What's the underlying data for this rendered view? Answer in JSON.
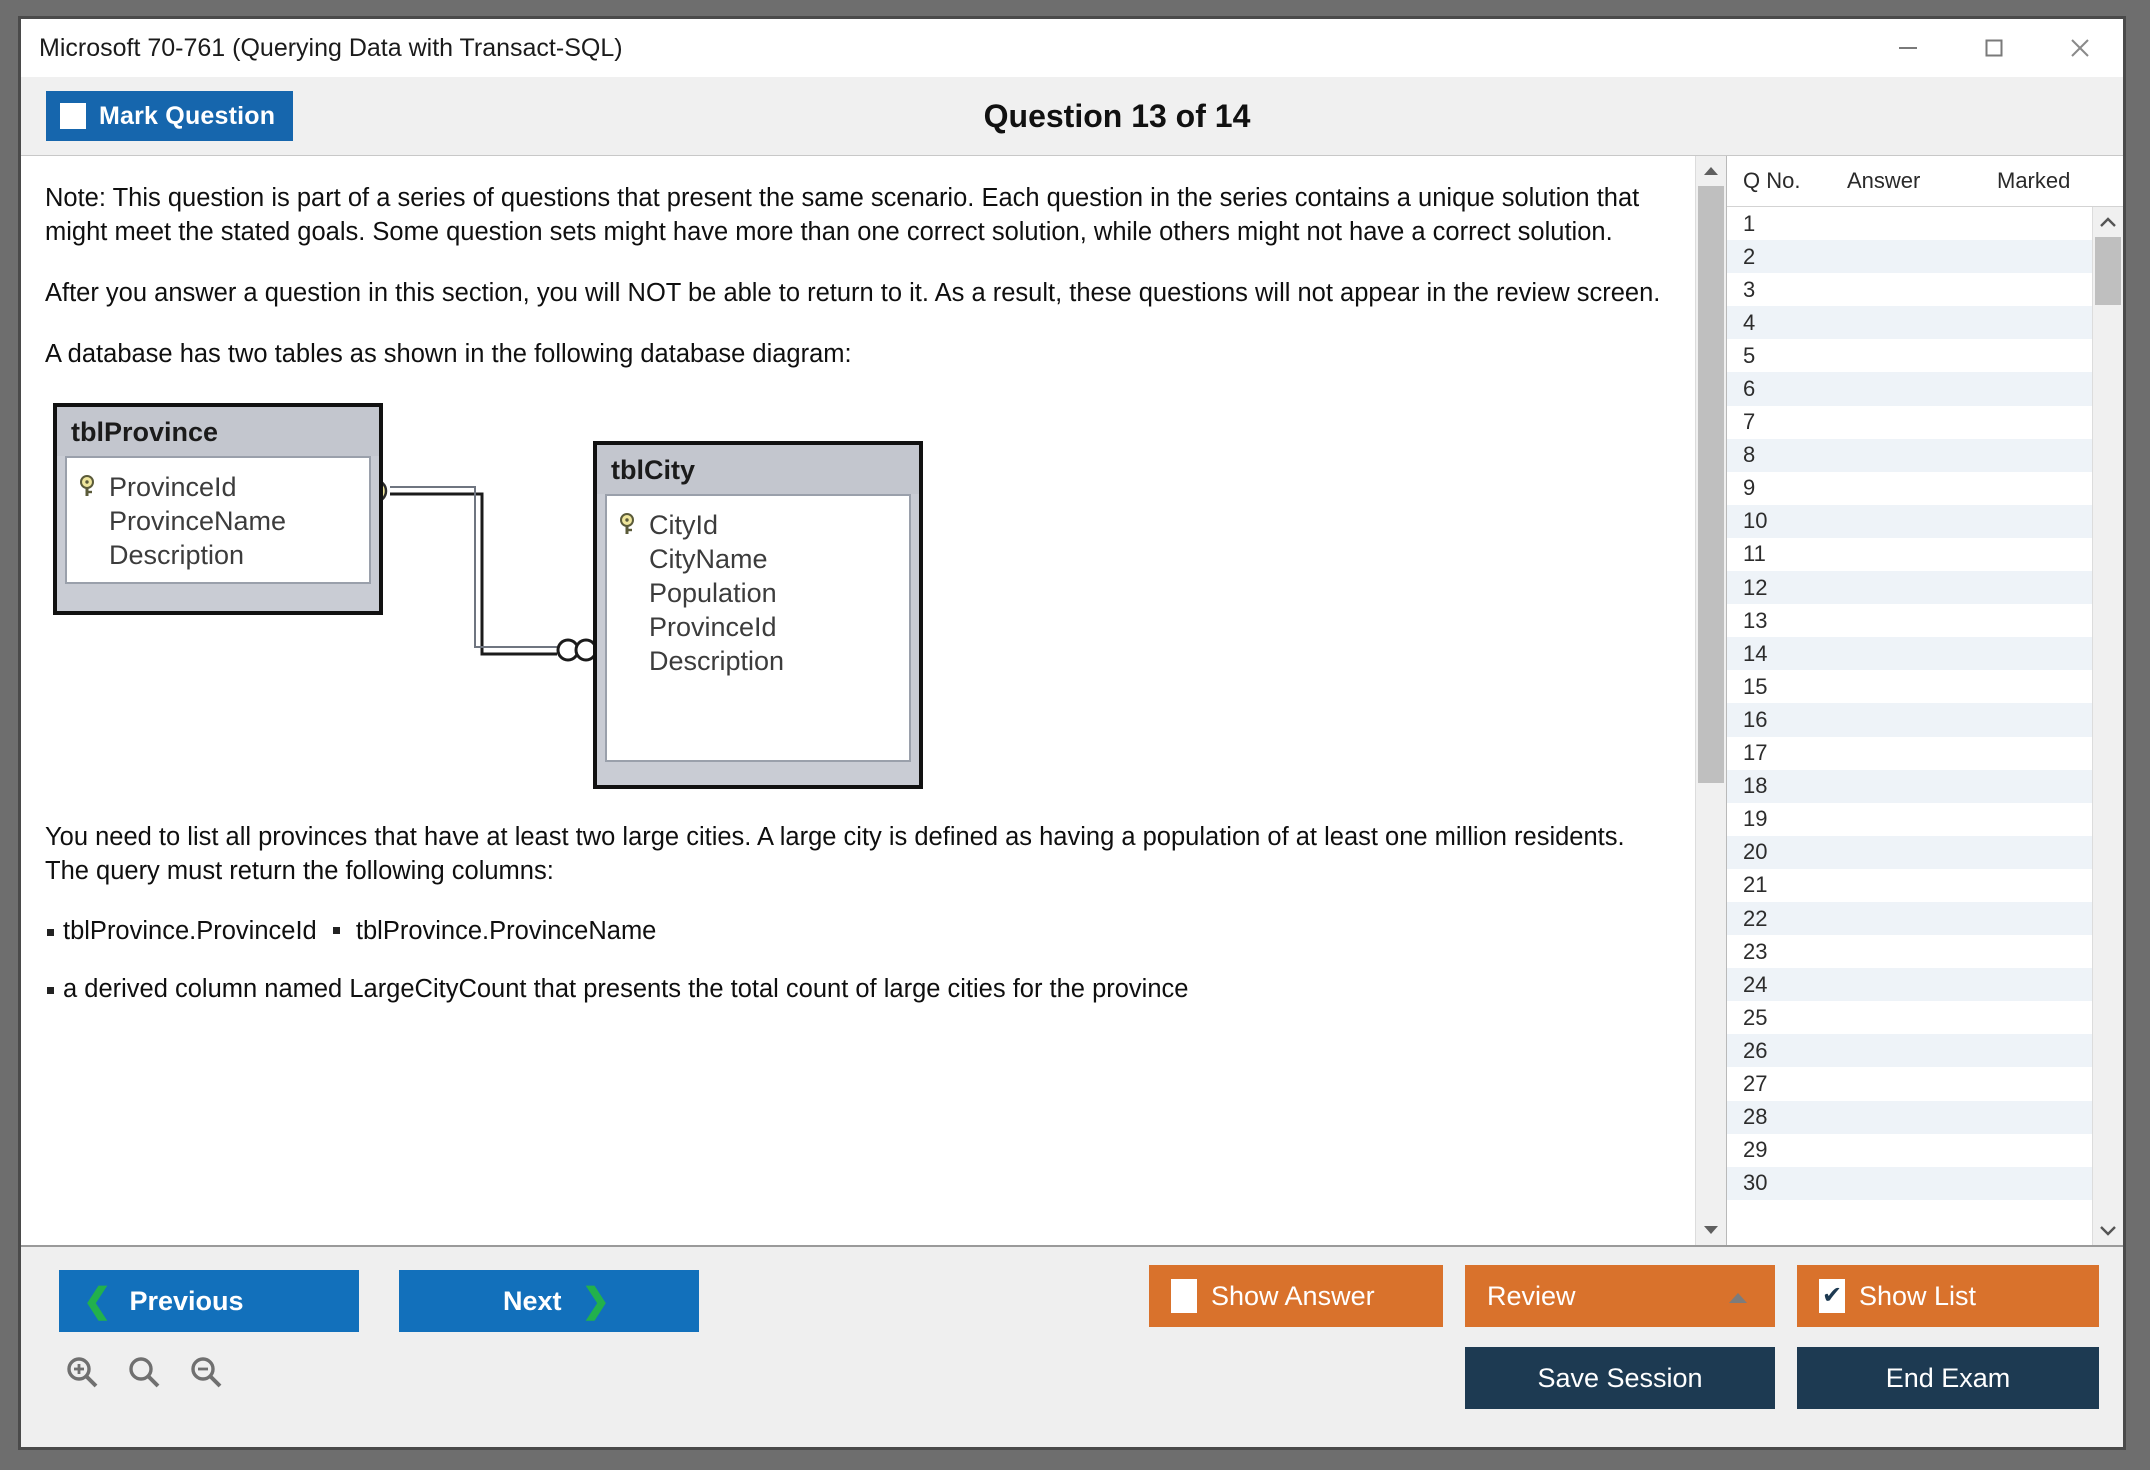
{
  "window": {
    "title": "Microsoft 70-761 (Querying Data with Transact-SQL)",
    "controls": {
      "minimize": "minimize-icon",
      "maximize": "maximize-icon",
      "close": "close-icon"
    }
  },
  "header": {
    "mark_question_label": "Mark Question",
    "mark_question_checked": false,
    "question_title": "Question 13 of 14"
  },
  "content": {
    "paragraphs": [
      "Note: This question is part of a series of questions that present the same scenario. Each question in the series contains a unique solution that might meet the stated goals. Some question sets might have more than one correct solution, while others might not have a correct solution.",
      "After you answer a question in this section, you will NOT be able to return to it. As a result, these questions will not appear in the review screen.",
      "A database has two tables as shown in the following database diagram:"
    ],
    "after_diagram_paragraph": "You need to list all provinces that have at least two large cities. A large city is defined as having a population of at least one million residents. The query must return the following columns:",
    "bullet_columns": [
      "tblProvince.ProvinceId",
      "tblProvince.ProvinceName"
    ],
    "bullet_derived": "a derived column named LargeCityCount that presents the total count of large cities for the province"
  },
  "diagram": {
    "tables": [
      {
        "name": "tblProvince",
        "fields": [
          {
            "label": "ProvinceId",
            "key": true
          },
          {
            "label": "ProvinceName",
            "key": false
          },
          {
            "label": "Description",
            "key": false
          }
        ]
      },
      {
        "name": "tblCity",
        "fields": [
          {
            "label": "CityId",
            "key": true
          },
          {
            "label": "CityName",
            "key": false
          },
          {
            "label": "Population",
            "key": false
          },
          {
            "label": "ProvinceId",
            "key": false
          },
          {
            "label": "Description",
            "key": false
          }
        ]
      }
    ],
    "relationship": {
      "type": "one-to-many",
      "from_symbol": "key-icon",
      "to_symbol": "infinity-icon"
    }
  },
  "question_panel": {
    "columns": [
      "Q No.",
      "Answer",
      "Marked"
    ],
    "rows": [
      {
        "qno": "1",
        "answer": "",
        "marked": ""
      },
      {
        "qno": "2",
        "answer": "",
        "marked": ""
      },
      {
        "qno": "3",
        "answer": "",
        "marked": ""
      },
      {
        "qno": "4",
        "answer": "",
        "marked": ""
      },
      {
        "qno": "5",
        "answer": "",
        "marked": ""
      },
      {
        "qno": "6",
        "answer": "",
        "marked": ""
      },
      {
        "qno": "7",
        "answer": "",
        "marked": ""
      },
      {
        "qno": "8",
        "answer": "",
        "marked": ""
      },
      {
        "qno": "9",
        "answer": "",
        "marked": ""
      },
      {
        "qno": "10",
        "answer": "",
        "marked": ""
      },
      {
        "qno": "11",
        "answer": "",
        "marked": ""
      },
      {
        "qno": "12",
        "answer": "",
        "marked": ""
      },
      {
        "qno": "13",
        "answer": "",
        "marked": ""
      },
      {
        "qno": "14",
        "answer": "",
        "marked": ""
      },
      {
        "qno": "15",
        "answer": "",
        "marked": ""
      },
      {
        "qno": "16",
        "answer": "",
        "marked": ""
      },
      {
        "qno": "17",
        "answer": "",
        "marked": ""
      },
      {
        "qno": "18",
        "answer": "",
        "marked": ""
      },
      {
        "qno": "19",
        "answer": "",
        "marked": ""
      },
      {
        "qno": "20",
        "answer": "",
        "marked": ""
      },
      {
        "qno": "21",
        "answer": "",
        "marked": ""
      },
      {
        "qno": "22",
        "answer": "",
        "marked": ""
      },
      {
        "qno": "23",
        "answer": "",
        "marked": ""
      },
      {
        "qno": "24",
        "answer": "",
        "marked": ""
      },
      {
        "qno": "25",
        "answer": "",
        "marked": ""
      },
      {
        "qno": "26",
        "answer": "",
        "marked": ""
      },
      {
        "qno": "27",
        "answer": "",
        "marked": ""
      },
      {
        "qno": "28",
        "answer": "",
        "marked": ""
      },
      {
        "qno": "29",
        "answer": "",
        "marked": ""
      },
      {
        "qno": "30",
        "answer": "",
        "marked": ""
      }
    ]
  },
  "footer": {
    "previous_label": "Previous",
    "next_label": "Next",
    "show_answer_label": "Show Answer",
    "show_answer_checked": false,
    "review_label": "Review",
    "show_list_label": "Show List",
    "show_list_checked": true,
    "show_list_check_glyph": "✔",
    "save_session_label": "Save Session",
    "end_exam_label": "End Exam",
    "zoom_icons": [
      "zoom-in-icon",
      "zoom-reset-icon",
      "zoom-out-icon"
    ]
  },
  "colors": {
    "accent_blue": "#1270bb",
    "accent_orange": "#d9722c",
    "accent_dark": "#1d3a52",
    "chevron_green": "#22b14c",
    "row_alt": "#eef3f8"
  }
}
